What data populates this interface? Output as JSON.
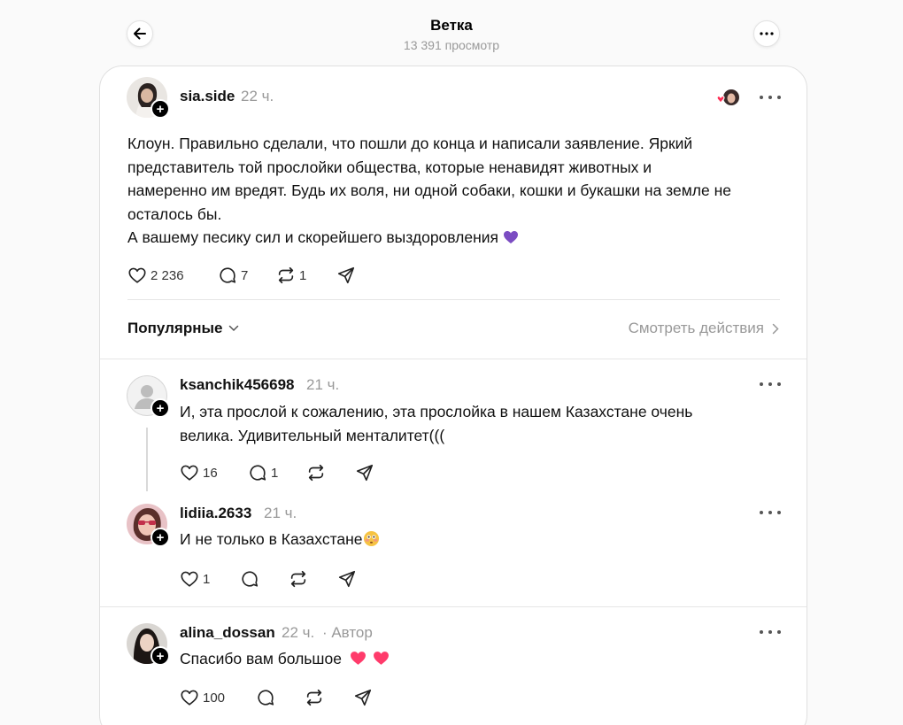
{
  "header": {
    "title": "Ветка",
    "views": "13 391 просмотр"
  },
  "post": {
    "username": "sia.side",
    "time": "22 ч.",
    "text_lines": [
      "Клоун. Правильно сделали, что пошли до конца и написали заявление. Яркий",
      "представитель той прослойки общества, которые ненавидят животных и",
      "намеренно им вредят. Будь их воля, ни одной собаки, кошки и букашки на земле не",
      "осталось бы."
    ],
    "text_last": "А вашему песику сил и скорейшего выздоровления",
    "likes": "2 236",
    "comments": "7",
    "reposts": "1"
  },
  "filter": {
    "sort_label": "Популярные",
    "view_actions_label": "Смотреть действия"
  },
  "replies": [
    {
      "username": "ksanchik456698",
      "time": "21 ч.",
      "text_lines": [
        "И, эта прослой к сожалению, эта прослойка в нашем Казахстане очень",
        "велика. Удивительный менталитет((("
      ],
      "likes": "16",
      "comments": "1"
    },
    {
      "username": "lidiia.2633",
      "time": "21 ч.",
      "text": "И не только в Казахстане",
      "likes": "1"
    },
    {
      "username": "alina_dossan",
      "time": "22 ч.",
      "author_label": "· Автор",
      "text": "Спасибо вам большое",
      "likes": "100"
    }
  ],
  "icons": {
    "back": "arrow-left-icon",
    "more": "more-horizontal-icon",
    "like": "heart-icon",
    "comment": "comment-icon",
    "repost": "repost-icon",
    "share": "send-icon"
  },
  "colors": {
    "accent_pink": "#ff3b6b",
    "muted": "#999999"
  }
}
